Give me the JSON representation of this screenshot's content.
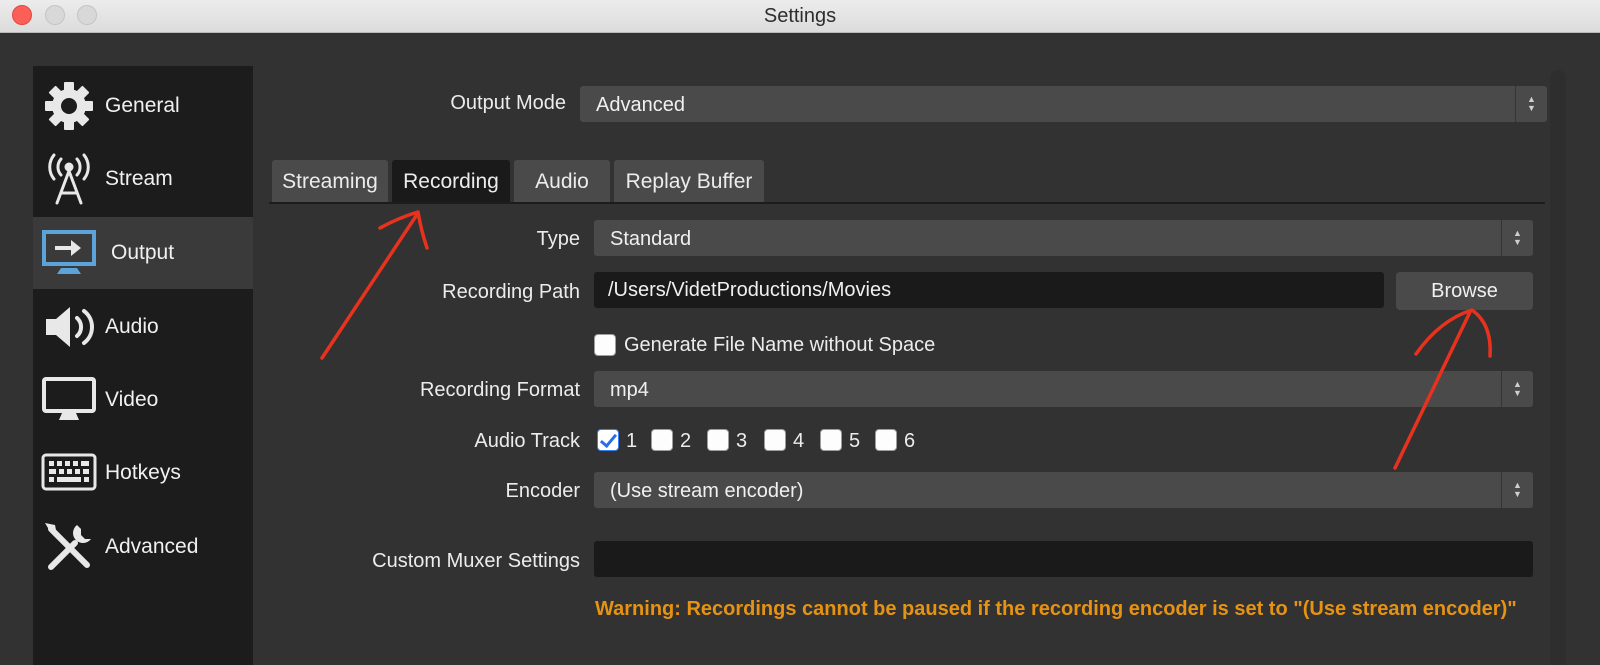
{
  "window": {
    "title": "Settings"
  },
  "sidebar": {
    "items": [
      {
        "label": "General",
        "icon": "gear-icon"
      },
      {
        "label": "Stream",
        "icon": "broadcast-tower-icon"
      },
      {
        "label": "Output",
        "icon": "monitor-output-icon",
        "active": true
      },
      {
        "label": "Audio",
        "icon": "speaker-icon"
      },
      {
        "label": "Video",
        "icon": "monitor-icon"
      },
      {
        "label": "Hotkeys",
        "icon": "keyboard-icon"
      },
      {
        "label": "Advanced",
        "icon": "tools-icon"
      }
    ]
  },
  "output_mode": {
    "label": "Output Mode",
    "value": "Advanced"
  },
  "tabs": [
    {
      "label": "Streaming"
    },
    {
      "label": "Recording",
      "active": true
    },
    {
      "label": "Audio"
    },
    {
      "label": "Replay Buffer"
    }
  ],
  "recording": {
    "type": {
      "label": "Type",
      "value": "Standard"
    },
    "path": {
      "label": "Recording Path",
      "value": "/Users/VidetProductions/Movies",
      "browse_label": "Browse"
    },
    "filename_nospace": {
      "label": "Generate File Name without Space",
      "checked": false
    },
    "format": {
      "label": "Recording Format",
      "value": "mp4"
    },
    "audio_track": {
      "label": "Audio Track",
      "tracks": [
        {
          "label": "1",
          "checked": true
        },
        {
          "label": "2",
          "checked": false
        },
        {
          "label": "3",
          "checked": false
        },
        {
          "label": "4",
          "checked": false
        },
        {
          "label": "5",
          "checked": false
        },
        {
          "label": "6",
          "checked": false
        }
      ]
    },
    "encoder": {
      "label": "Encoder",
      "value": "(Use stream encoder)"
    },
    "muxer": {
      "label": "Custom Muxer Settings",
      "value": ""
    },
    "warning": "Warning: Recordings cannot be paused if the recording encoder is set to \"(Use stream encoder)\""
  },
  "colors": {
    "annotation": "#e8321e",
    "warning": "#e69212",
    "checkbox_accent": "#2a6fe8"
  }
}
